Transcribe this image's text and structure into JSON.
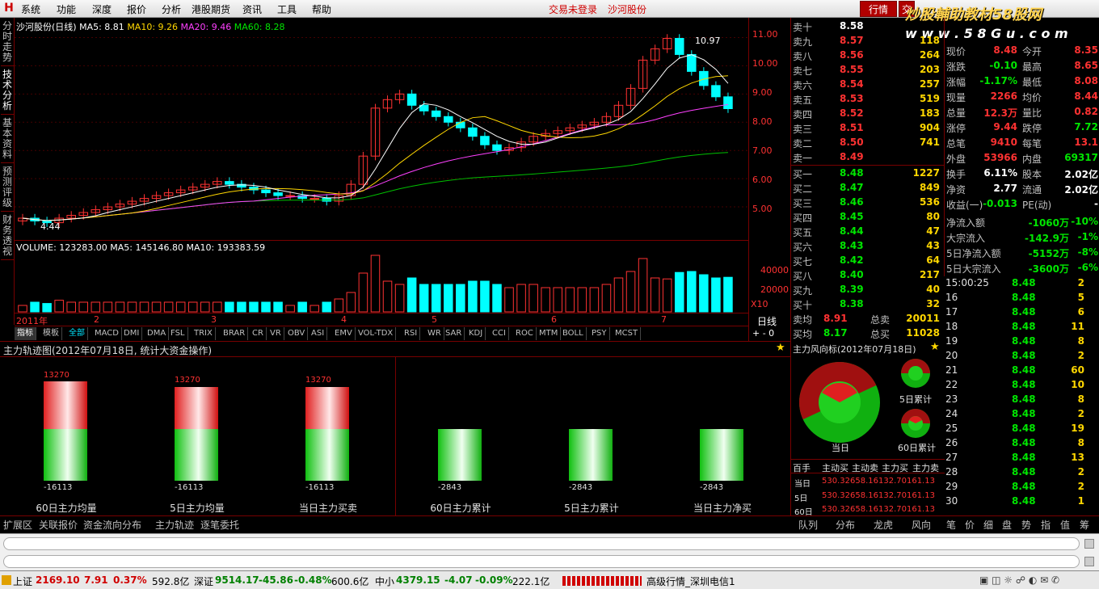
{
  "menu": {
    "items": [
      "系统",
      "功能",
      "深度",
      "报价",
      "分析",
      "港股期货",
      "资讯",
      "工具",
      "帮助"
    ],
    "status_login": "交易未登录",
    "stock_name": "沙河股份",
    "tab_quote": "行情",
    "tab_trade": "交"
  },
  "watermark": {
    "line1": "炒股輔助教材58股网",
    "line2": "w w w . 5 8 G u . c o m"
  },
  "vtabs": [
    "分时走势",
    "技术分析",
    "基本资料",
    "预测评级",
    "财务透视"
  ],
  "kline": {
    "title": "沙河股份(日线)",
    "ma5": "MA5: 8.81",
    "ma10": "MA10: 9.26",
    "ma20": "MA20: 9.46",
    "ma60": "MA60: 8.28",
    "high_mark": "10.97",
    "low_mark": "4.44",
    "y_ticks": [
      "11.00",
      "10.00",
      "9.00",
      "8.00",
      "7.00",
      "6.00",
      "5.00"
    ]
  },
  "volume": {
    "title": "VOLUME: 123283.00",
    "ma5": "MA5: 145146.80",
    "ma10": "MA10: 193383.59",
    "y_ticks": [
      "40000",
      "20000"
    ],
    "unit": "X10"
  },
  "dates": [
    "2011年",
    "2",
    "3",
    "4",
    "5",
    "6",
    "7"
  ],
  "period": "日线",
  "indicators": [
    "指标",
    "模板",
    "全部",
    "MACD",
    "DMI",
    "DMA",
    "FSL",
    "TRIX",
    "BRAR",
    "CR",
    "VR",
    "OBV",
    "ASI",
    "EMV",
    "VOL-TDX",
    "RSI",
    "WR",
    "SAR",
    "KDJ",
    "CCI",
    "ROC",
    "MTM",
    "BOLL",
    "PSY",
    "MCST"
  ],
  "sells": [
    {
      "label": "卖十",
      "price": "8.58",
      "vol": ""
    },
    {
      "label": "卖九",
      "price": "8.57",
      "vol": "118"
    },
    {
      "label": "卖八",
      "price": "8.56",
      "vol": "264"
    },
    {
      "label": "卖七",
      "price": "8.55",
      "vol": "203"
    },
    {
      "label": "卖六",
      "price": "8.54",
      "vol": "257"
    },
    {
      "label": "卖五",
      "price": "8.53",
      "vol": "519"
    },
    {
      "label": "卖四",
      "price": "8.52",
      "vol": "183"
    },
    {
      "label": "卖三",
      "price": "8.51",
      "vol": "904"
    },
    {
      "label": "卖二",
      "price": "8.50",
      "vol": "741"
    },
    {
      "label": "卖一",
      "price": "8.49",
      "vol": ""
    }
  ],
  "buys": [
    {
      "label": "买一",
      "price": "8.48",
      "vol": "1227"
    },
    {
      "label": "买二",
      "price": "8.47",
      "vol": "849"
    },
    {
      "label": "买三",
      "price": "8.46",
      "vol": "536"
    },
    {
      "label": "买四",
      "price": "8.45",
      "vol": "80"
    },
    {
      "label": "买五",
      "price": "8.44",
      "vol": "47"
    },
    {
      "label": "买六",
      "price": "8.43",
      "vol": "43"
    },
    {
      "label": "买七",
      "price": "8.42",
      "vol": "64"
    },
    {
      "label": "买八",
      "price": "8.40",
      "vol": "217"
    },
    {
      "label": "买九",
      "price": "8.39",
      "vol": "40"
    },
    {
      "label": "买十",
      "price": "8.38",
      "vol": "32"
    }
  ],
  "avg": {
    "sell_avg_lbl": "卖均",
    "sell_avg": "8.91",
    "sell_total_lbl": "总卖",
    "sell_total": "20011",
    "buy_avg_lbl": "买均",
    "buy_avg": "8.17",
    "buy_total_lbl": "总买",
    "buy_total": "11028"
  },
  "stats": [
    {
      "l1": "现价",
      "v1": "8.48",
      "l2": "今开",
      "v2": "8.35"
    },
    {
      "l1": "涨跌",
      "v1": "-0.10",
      "l2": "最高",
      "v2": "8.65"
    },
    {
      "l1": "涨幅",
      "v1": "-1.17%",
      "l2": "最低",
      "v2": "8.08"
    },
    {
      "l1": "现量",
      "v1": "2266",
      "l2": "均价",
      "v2": "8.44"
    },
    {
      "l1": "总量",
      "v1": "12.3万",
      "l2": "量比",
      "v2": "0.82"
    },
    {
      "l1": "涨停",
      "v1": "9.44",
      "l2": "跌停",
      "v2": "7.72"
    },
    {
      "l1": "总笔",
      "v1": "9410",
      "l2": "每笔",
      "v2": "13.1"
    },
    {
      "l1": "外盘",
      "v1": "53966",
      "l2": "内盘",
      "v2": "69317"
    },
    {
      "l1": "换手",
      "v1": "6.11%",
      "l2": "股本",
      "v2": "2.02亿"
    },
    {
      "l1": "净资",
      "v1": "2.77",
      "l2": "流通",
      "v2": "2.02亿"
    },
    {
      "l1": "收益(一)",
      "v1": "-0.013",
      "l2": "PE(动)",
      "v2": "-"
    }
  ],
  "flows": [
    {
      "l": "净流入额",
      "v": "-1060万",
      "p": "-10%"
    },
    {
      "l": "大宗流入",
      "v": "-142.9万",
      "p": "-1%"
    },
    {
      "l": "5日净流入额",
      "v": "-5152万",
      "p": "-8%"
    },
    {
      "l": "5日大宗流入",
      "v": "-3600万",
      "p": "-6%"
    }
  ],
  "ticks": [
    {
      "t": "15:00:25",
      "p": "8.48",
      "v": "2"
    },
    {
      "t": "16",
      "p": "8.48",
      "v": "5"
    },
    {
      "t": "17",
      "p": "8.48",
      "v": "6"
    },
    {
      "t": "18",
      "p": "8.48",
      "v": "11"
    },
    {
      "t": "19",
      "p": "8.48",
      "v": "8"
    },
    {
      "t": "20",
      "p": "8.48",
      "v": "2"
    },
    {
      "t": "21",
      "p": "8.48",
      "v": "60"
    },
    {
      "t": "22",
      "p": "8.48",
      "v": "10"
    },
    {
      "t": "23",
      "p": "8.48",
      "v": "8"
    },
    {
      "t": "24",
      "p": "8.48",
      "v": "2"
    },
    {
      "t": "25",
      "p": "8.48",
      "v": "19"
    },
    {
      "t": "26",
      "p": "8.48",
      "v": "8"
    },
    {
      "t": "27",
      "p": "8.48",
      "v": "13"
    },
    {
      "t": "28",
      "p": "8.48",
      "v": "2"
    },
    {
      "t": "29",
      "p": "8.48",
      "v": "2"
    },
    {
      "t": "30",
      "p": "8.48",
      "v": "1"
    }
  ],
  "panel": {
    "title": "主力轨迹图(2012年07月18日, 统计大资金操作)",
    "bars": [
      {
        "label": "60日主力均量",
        "top": "13270",
        "bottom": "-16113"
      },
      {
        "label": "5日主力均量",
        "top": "13270",
        "bottom": "-16113"
      },
      {
        "label": "当日主力买卖",
        "top": "13270",
        "bottom": "-16113"
      },
      {
        "label": "60日主力累计",
        "top": "",
        "bottom": "-2843"
      },
      {
        "label": "5日主力累计",
        "top": "",
        "bottom": "-2843"
      },
      {
        "label": "当日主力净买",
        "top": "",
        "bottom": "-2843"
      }
    ]
  },
  "direction": {
    "title": "主力风向标(2012年07月18日)",
    "today": "当日",
    "five": "5日累计",
    "sixty": "60日累计",
    "table_headers": [
      "百手",
      "主动买",
      "主动卖",
      "主力买",
      "主力卖"
    ],
    "rows": [
      {
        "label": "当日",
        "vals": "530.32658.16132.70161.13"
      },
      {
        "label": "5日",
        "vals": "530.32658.16132.70161.13"
      },
      {
        "label": "60日",
        "vals": "530.32658.16132.70161.13"
      }
    ],
    "tabs": [
      "队列",
      "分布",
      "龙虎",
      "风向"
    ]
  },
  "right_tabs": [
    "笔",
    "价",
    "细",
    "盘",
    "势",
    "指",
    "值",
    "筹"
  ],
  "bottom_tabs": [
    "扩展区",
    "关联报价",
    "资金流向分布",
    "主力轨迹",
    "逐笔委托"
  ],
  "status": {
    "sh_name": "上证",
    "sh_val": "2169.10",
    "sh_chg": "7.91",
    "sh_pct": "0.37%",
    "sh_amt": "592.8亿",
    "sz_name": "深证",
    "sz_val": "9514.17",
    "sz_chg": "-45.86",
    "sz_pct": "-0.48%",
    "sz_amt": "600.6亿",
    "zx_name": "中小",
    "zx_val": "4379.15",
    "zx_chg": "-4.07",
    "zx_pct": "-0.09%",
    "zx_amt": "222.1亿",
    "server": "高级行情_深圳电信1"
  },
  "chart_data": {
    "type": "candlestick",
    "title": "沙河股份(日线)",
    "ylim": [
      4.2,
      11.3
    ],
    "closes": [
      4.6,
      4.5,
      4.44,
      4.6,
      4.7,
      4.8,
      4.9,
      5.0,
      5.1,
      5.2,
      5.3,
      5.4,
      5.5,
      5.6,
      5.7,
      5.8,
      5.9,
      5.8,
      5.7,
      5.6,
      5.5,
      5.4,
      5.4,
      5.3,
      5.3,
      5.2,
      5.4,
      5.8,
      6.8,
      8.5,
      8.8,
      9.0,
      8.6,
      8.4,
      8.2,
      8.0,
      7.8,
      7.5,
      7.2,
      7.0,
      7.1,
      7.3,
      7.5,
      7.6,
      7.7,
      7.8,
      7.9,
      8.0,
      8.2,
      8.6,
      9.2,
      10.2,
      10.6,
      10.97,
      10.4,
      9.8,
      9.3,
      8.9,
      8.48
    ]
  }
}
